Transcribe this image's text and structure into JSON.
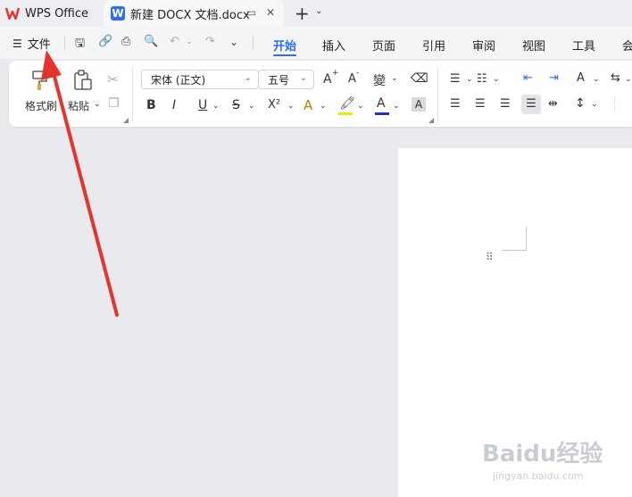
{
  "tabbar": {
    "app_label": "WPS Office",
    "doc_tab_label": "新建 DOCX 文档.docx",
    "new_tab_plus": "+"
  },
  "menubar": {
    "file_label": "文件",
    "tabs": [
      "开始",
      "插入",
      "页面",
      "引用",
      "审阅",
      "视图",
      "工具",
      "会"
    ],
    "active_tab": "开始"
  },
  "ribbon": {
    "format_painter_label": "格式刷",
    "paste_label": "粘贴",
    "font_name": "宋体 (正文)",
    "font_size": "五号",
    "bold": "B",
    "italic": "I",
    "underline": "U",
    "strikethrough": "S",
    "superscript": "X²",
    "text_effect": "A",
    "font_color": "A",
    "char_shading": "A",
    "grow_font": "A",
    "shrink_font": "A",
    "phonetic": "變",
    "clear_format": "⌫"
  },
  "watermark": {
    "main": "Baidu经验",
    "sub": "jingyan.baidu.com"
  },
  "colors": {
    "accent": "#2f6df6",
    "wps_red": "#e8332b",
    "arrow_red": "#e8332b",
    "highlight_yellow": "#f5e300",
    "font_color_blue": "#1a33d6"
  }
}
